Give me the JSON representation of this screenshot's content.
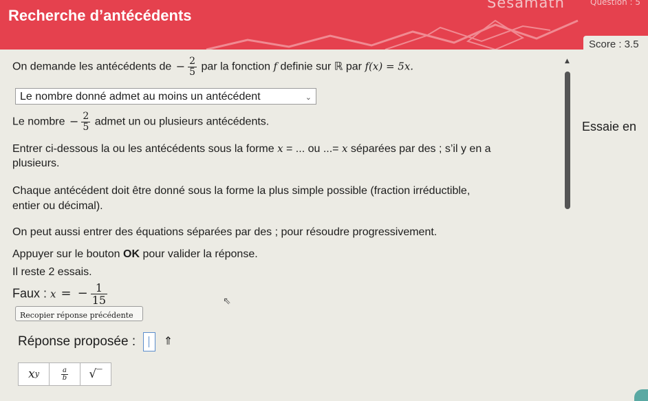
{
  "header": {
    "title": "Recherche d’antécédents",
    "brand": "Sesamath",
    "question_label": "Question : 5",
    "score": "Score : 3.5",
    "accent_color": "#e5414e"
  },
  "exercise": {
    "intro_before": "On demande les antécédents de",
    "intro_num": "2",
    "intro_den": "5",
    "intro_after": "par la fonction",
    "intro_f": "f",
    "intro_after2": "definie sur ℝ par",
    "intro_formula": "f(x) = 5x.",
    "dropdown_value": "Le nombre donné admet au moins un antécédent",
    "statement_before": "Le nombre",
    "statement_num": "2",
    "statement_den": "5",
    "statement_after": "admet un ou plusieurs antécédents.",
    "instruction1_a": "Entrer ci-dessous la ou les antécédents sous la forme",
    "instruction1_x1": "x",
    "instruction1_b": "= ... ou ...=",
    "instruction1_x2": "x",
    "instruction1_c": "séparées par des ; s’il y en a",
    "instruction1_line2": "plusieurs.",
    "instruction2_line1": "Chaque antécédent doit être donné sous la forme la plus simple possible (fraction irréductible,",
    "instruction2_line2": "entier ou décimal).",
    "instruction3": "On peut aussi entrer des équations séparées par des ; pour résoudre progressivement.",
    "instruction4_a": "Appuyer sur le bouton",
    "instruction4_ok": "OK",
    "instruction4_b": "pour valider la réponse.",
    "tries_left": "Il reste 2 essais.",
    "wrong_label": "Faux :",
    "wrong_x": "x",
    "wrong_eq": "=",
    "wrong_num": "1",
    "wrong_den": "15",
    "recopy_button": "Recopier réponse précédente",
    "answer_label": "Réponse proposée :",
    "side_label": "Essaie en"
  },
  "toolbar": {
    "power_base": "x",
    "power_exp": "y",
    "fraction_num": "a",
    "fraction_den": "b",
    "sqrt_label": "√‾"
  }
}
